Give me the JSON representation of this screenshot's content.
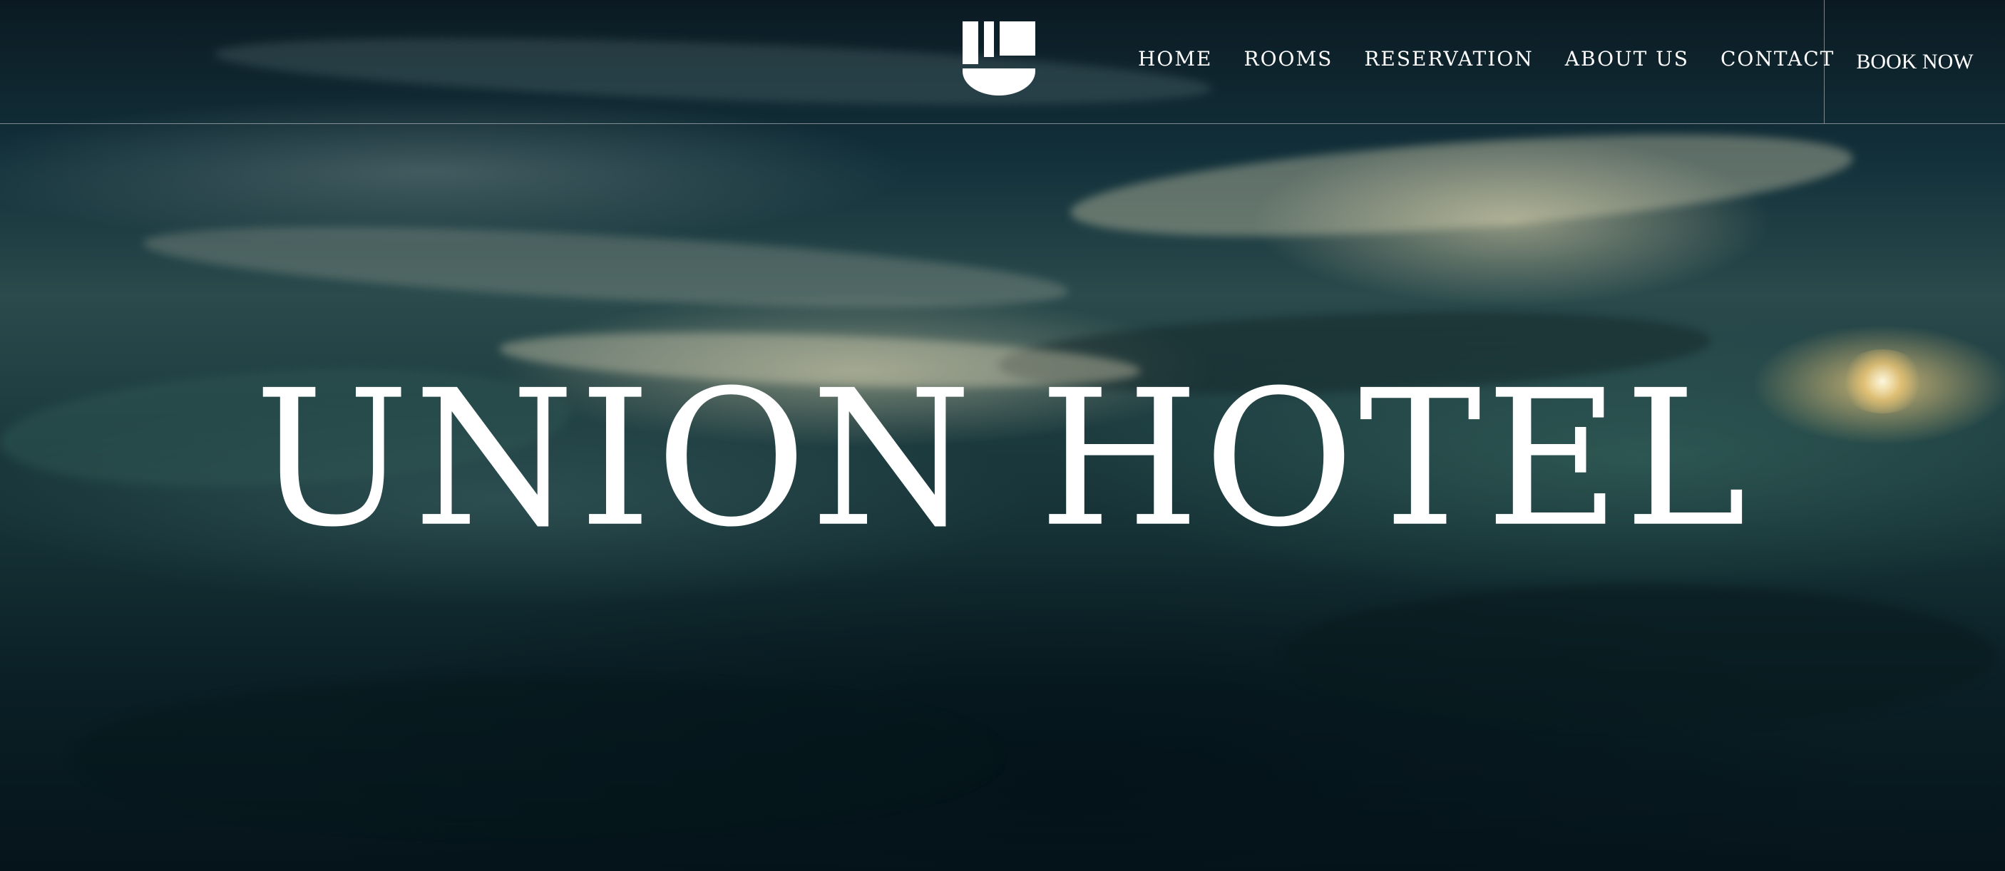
{
  "header": {
    "logo_icon": "union-u-logo-icon",
    "nav": [
      {
        "label": "HOME"
      },
      {
        "label": "ROOMS"
      },
      {
        "label": "RESERVATION"
      },
      {
        "label": "ABOUT US"
      },
      {
        "label": "CONTACT"
      }
    ],
    "book_now_label": "BOOK NOW"
  },
  "hero": {
    "title": "UNION HOTEL",
    "background": "dark-teal-water-with-golden-light"
  },
  "colors": {
    "text": "#ffffff",
    "background_dark": "#061a22",
    "highlight_gold": "#f0e2b4"
  }
}
